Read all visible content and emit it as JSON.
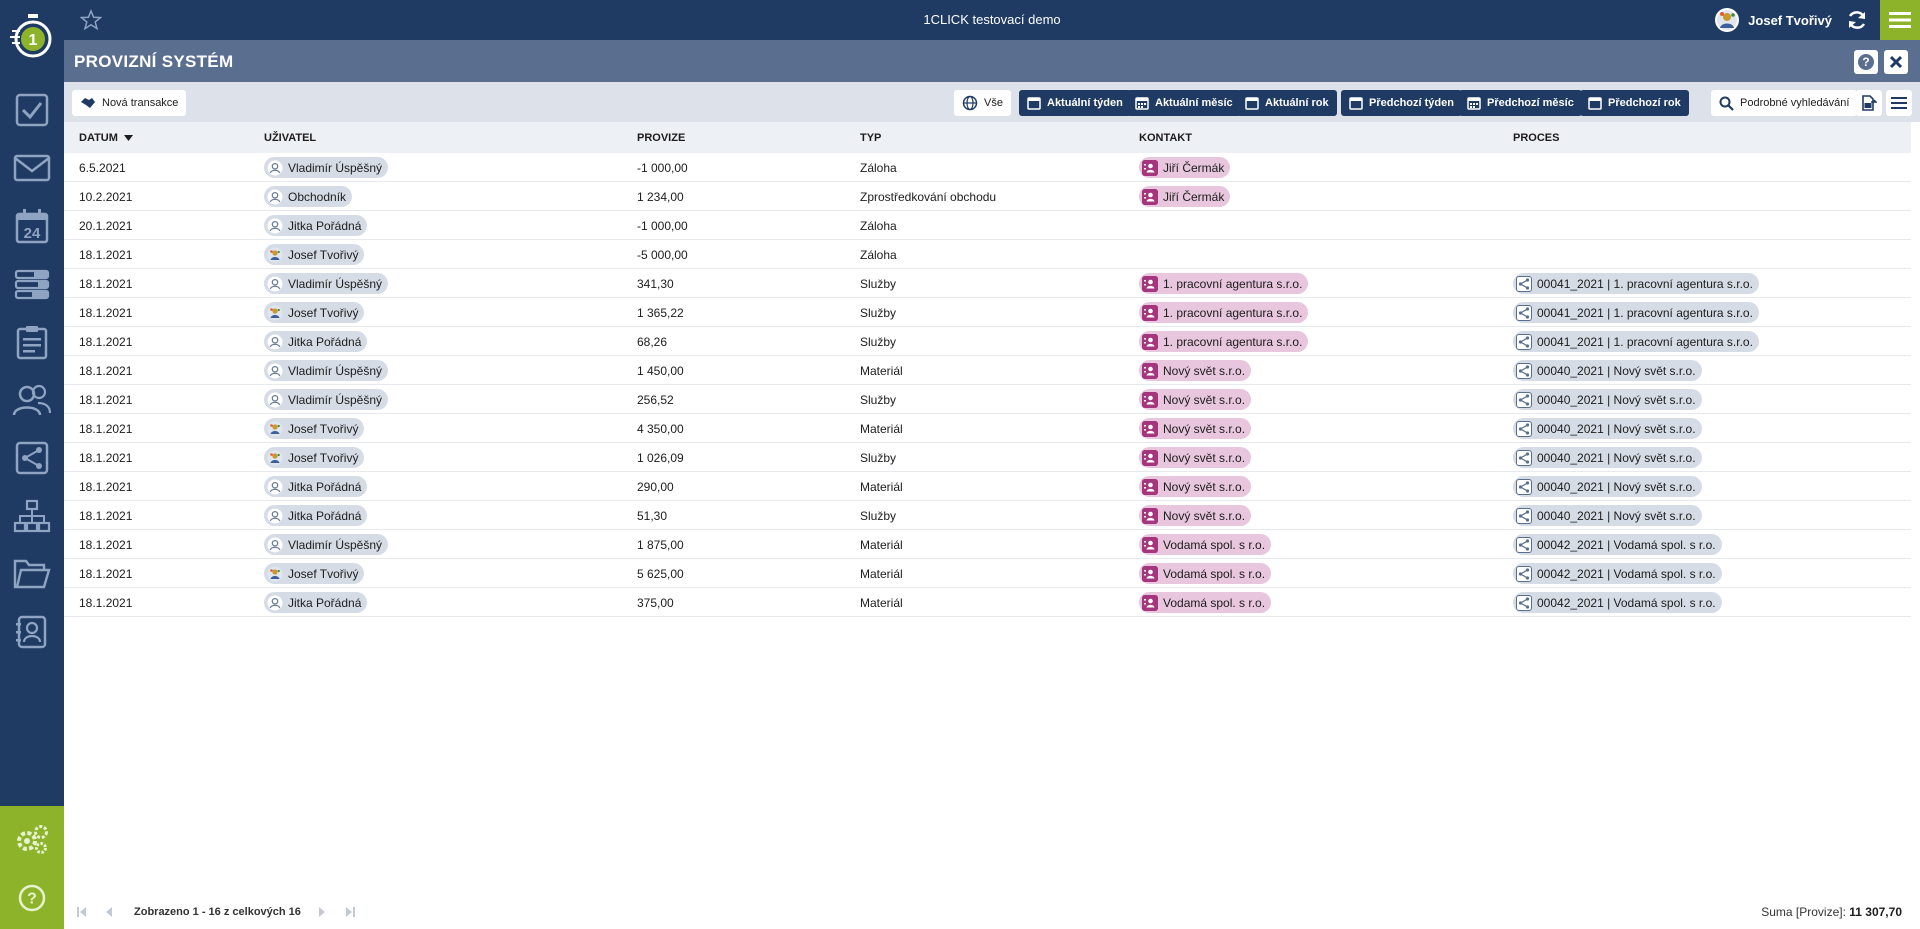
{
  "topbar": {
    "app_title": "1CLICK testovací demo",
    "user_name": "Josef Tvořivý"
  },
  "page": {
    "title": "PROVIZNÍ SYSTÉM"
  },
  "toolbar": {
    "new_transaction": "Nová transakce",
    "all": "Vše",
    "current_week": "Aktuální týden",
    "current_month": "Aktuální měsíc",
    "current_year": "Aktuální rok",
    "prev_week": "Předchozí týden",
    "prev_month": "Předchozí měsíc",
    "prev_year": "Předchozí rok",
    "advanced_search": "Podrobné vyhledávání"
  },
  "table": {
    "columns": [
      "Datum",
      "Uživatel",
      "Provize",
      "Typ",
      "Kontakt",
      "Proces"
    ],
    "rows": [
      {
        "date": "6.5.2021",
        "user": "Vladimír Úspěšný",
        "avatar": "person",
        "amount": "-1 000,00",
        "type": "Záloha",
        "contact": "Jiří Čermák",
        "process": ""
      },
      {
        "date": "10.2.2021",
        "user": "Obchodník",
        "avatar": "person",
        "amount": "1 234,00",
        "type": "Zprostředkování obchodu",
        "contact": "Jiří Čermák",
        "process": ""
      },
      {
        "date": "20.1.2021",
        "user": "Jitka Pořádná",
        "avatar": "person",
        "amount": "-1 000,00",
        "type": "Záloha",
        "contact": "",
        "process": ""
      },
      {
        "date": "18.1.2021",
        "user": "Josef Tvořivý",
        "avatar": "photo",
        "amount": "-5 000,00",
        "type": "Záloha",
        "contact": "",
        "process": ""
      },
      {
        "date": "18.1.2021",
        "user": "Vladimír Úspěšný",
        "avatar": "person",
        "amount": "341,30",
        "type": "Služby",
        "contact": "1. pracovní agentura s.r.o.",
        "process": "00041_2021 | 1. pracovní agentura s.r.o."
      },
      {
        "date": "18.1.2021",
        "user": "Josef Tvořivý",
        "avatar": "photo",
        "amount": "1 365,22",
        "type": "Služby",
        "contact": "1. pracovní agentura s.r.o.",
        "process": "00041_2021 | 1. pracovní agentura s.r.o."
      },
      {
        "date": "18.1.2021",
        "user": "Jitka Pořádná",
        "avatar": "person",
        "amount": "68,26",
        "type": "Služby",
        "contact": "1. pracovní agentura s.r.o.",
        "process": "00041_2021 | 1. pracovní agentura s.r.o."
      },
      {
        "date": "18.1.2021",
        "user": "Vladimír Úspěšný",
        "avatar": "person",
        "amount": "1 450,00",
        "type": "Materiál",
        "contact": "Nový svět s.r.o.",
        "process": "00040_2021 | Nový svět s.r.o."
      },
      {
        "date": "18.1.2021",
        "user": "Vladimír Úspěšný",
        "avatar": "person",
        "amount": "256,52",
        "type": "Služby",
        "contact": "Nový svět s.r.o.",
        "process": "00040_2021 | Nový svět s.r.o."
      },
      {
        "date": "18.1.2021",
        "user": "Josef Tvořivý",
        "avatar": "photo",
        "amount": "4 350,00",
        "type": "Materiál",
        "contact": "Nový svět s.r.o.",
        "process": "00040_2021 | Nový svět s.r.o."
      },
      {
        "date": "18.1.2021",
        "user": "Josef Tvořivý",
        "avatar": "photo",
        "amount": "1 026,09",
        "type": "Služby",
        "contact": "Nový svět s.r.o.",
        "process": "00040_2021 | Nový svět s.r.o."
      },
      {
        "date": "18.1.2021",
        "user": "Jitka Pořádná",
        "avatar": "person",
        "amount": "290,00",
        "type": "Materiál",
        "contact": "Nový svět s.r.o.",
        "process": "00040_2021 | Nový svět s.r.o."
      },
      {
        "date": "18.1.2021",
        "user": "Jitka Pořádná",
        "avatar": "person",
        "amount": "51,30",
        "type": "Služby",
        "contact": "Nový svět s.r.o.",
        "process": "00040_2021 | Nový svět s.r.o."
      },
      {
        "date": "18.1.2021",
        "user": "Vladimír Úspěšný",
        "avatar": "person",
        "amount": "1 875,00",
        "type": "Materiál",
        "contact": "Vodamá spol. s r.o.",
        "process": "00042_2021 | Vodamá spol. s r.o."
      },
      {
        "date": "18.1.2021",
        "user": "Josef Tvořivý",
        "avatar": "photo",
        "amount": "5 625,00",
        "type": "Materiál",
        "contact": "Vodamá spol. s r.o.",
        "process": "00042_2021 | Vodamá spol. s r.o."
      },
      {
        "date": "18.1.2021",
        "user": "Jitka Pořádná",
        "avatar": "person",
        "amount": "375,00",
        "type": "Materiál",
        "contact": "Vodamá spol. s r.o.",
        "process": "00042_2021 | Vodamá spol. s r.o."
      }
    ]
  },
  "footer": {
    "pager_text": "Zobrazeno 1 - 16 z celkových 16",
    "sum_label": "Suma [Provize]:",
    "sum_value": "11 307,70"
  },
  "colors": {
    "navy": "#1f3b63",
    "green": "#8db32a",
    "header_slate": "#5a6e90",
    "contact_chip": "#e8c6de",
    "contact_icon": "#a5357c"
  },
  "icons": {
    "sidebar": [
      "stopwatch-logo",
      "check-icon",
      "mail-icon",
      "calendar-24-icon",
      "list-icon",
      "clipboard-icon",
      "users-icon",
      "process-icon",
      "org-chart-icon",
      "folder-icon",
      "contact-card-icon"
    ],
    "settings": [
      "gears-icon",
      "help-icon"
    ]
  }
}
